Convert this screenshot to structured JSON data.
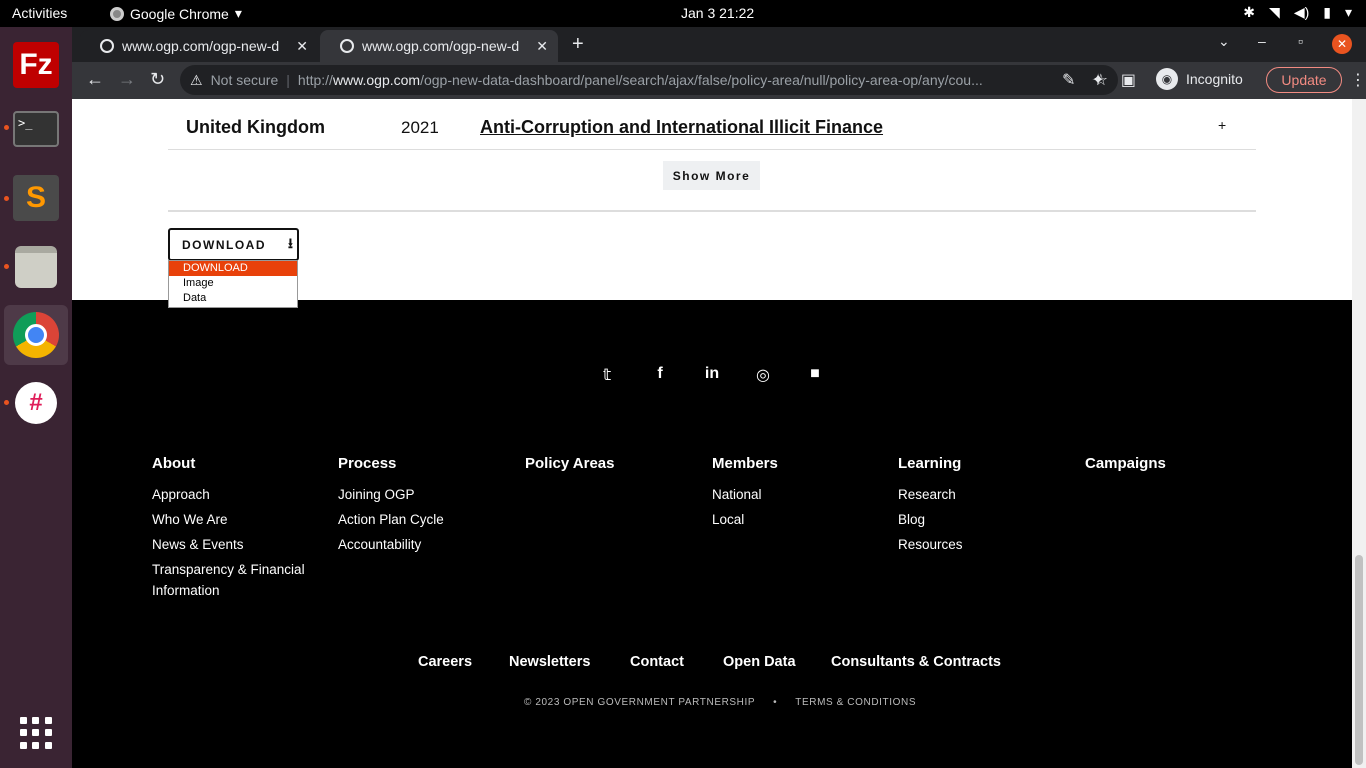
{
  "system_bar": {
    "activities": "Activities",
    "app_name": "Google Chrome",
    "app_menu_arrow": "▾",
    "clock": "Jan 3  21:22"
  },
  "dock": {
    "items": [
      "filezilla-icon",
      "terminal-icon",
      "sublime-text-icon",
      "files-icon",
      "chrome-icon",
      "slack-icon"
    ],
    "fz_label": "Fz",
    "term_label": ">_",
    "sublime_label": "S"
  },
  "browser": {
    "tabs": [
      {
        "title": "www.ogp.com/ogp-new-d"
      },
      {
        "title": "www.ogp.com/ogp-new-d"
      }
    ],
    "omnibox": {
      "security": "Not secure",
      "url_host": "www.ogp.com",
      "url_prefix": "http://",
      "url_path": "/ogp-new-data-dashboard/panel/search/ajax/false/policy-area/null/policy-area-op/any/cou..."
    },
    "incognito_label": "Incognito",
    "update_label": "Update"
  },
  "results": {
    "row": {
      "country": "United Kingdom",
      "year": "2021",
      "policy_area": "Anti-Corruption and International Illicit Finance",
      "expand": "+"
    },
    "show_more": "Show More",
    "download": {
      "label": "DOWNLOAD",
      "options": [
        "DOWNLOAD",
        "Image",
        "Data"
      ]
    }
  },
  "footer": {
    "social": [
      "twitter-icon",
      "facebook-icon",
      "linkedin-icon",
      "instagram-icon",
      "video-icon"
    ],
    "columns": [
      {
        "heading": "About",
        "links": [
          "Approach",
          "Who We Are",
          "News & Events",
          "Transparency & Financial Information"
        ]
      },
      {
        "heading": "Process",
        "links": [
          "Joining OGP",
          "Action Plan Cycle",
          "Accountability"
        ]
      },
      {
        "heading": "Policy Areas",
        "links": []
      },
      {
        "heading": "Members",
        "links": [
          "National",
          "Local"
        ]
      },
      {
        "heading": "Learning",
        "links": [
          "Research",
          "Blog",
          "Resources"
        ]
      },
      {
        "heading": "Campaigns",
        "links": []
      }
    ],
    "bottom_links": [
      "Careers",
      "Newsletters",
      "Contact",
      "Open Data",
      "Consultants & Contracts"
    ],
    "copyright": "© 2023 OPEN GOVERNMENT PARTNERSHIP",
    "bullet": "•",
    "terms": "TERMS & CONDITIONS"
  },
  "colors": {
    "accent": "#e8410a",
    "dock_bg": "#3a2433",
    "footer_bg": "#000000"
  }
}
